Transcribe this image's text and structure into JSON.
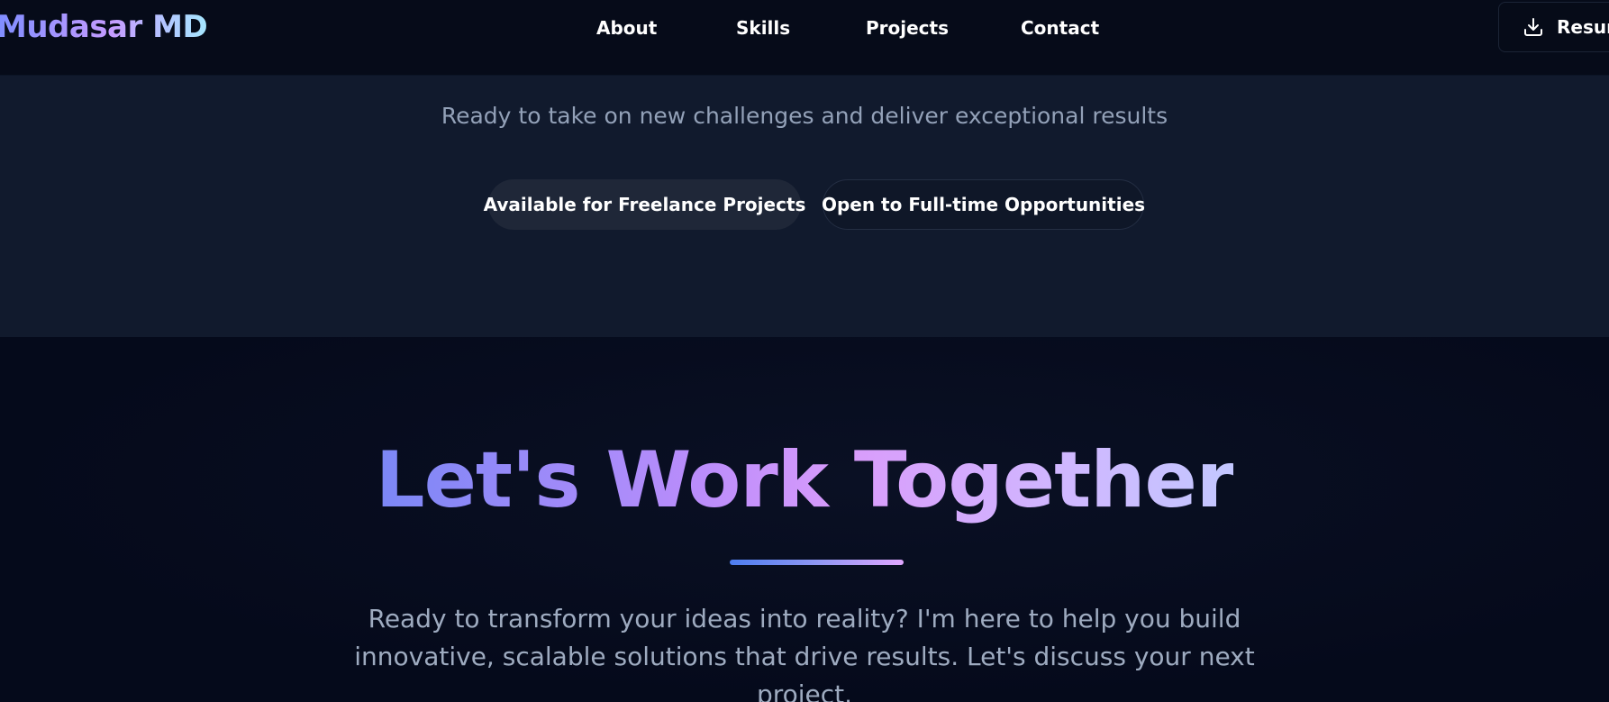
{
  "nav": {
    "logo": "Mudasar MD",
    "links": [
      "About",
      "Skills",
      "Projects",
      "Contact"
    ],
    "resume_label": "Resume",
    "resume_icon": "download-icon"
  },
  "availability": {
    "subtitle": "Ready to take on new challenges and deliver exceptional results",
    "badges": [
      "Available for Freelance Projects",
      "Open to Full-time Opportunities"
    ]
  },
  "cta": {
    "title": "Let's Work Together",
    "body": "Ready to transform your ideas into reality? I'm here to help you build innovative, scalable solutions that drive results. Let's discuss your next project."
  },
  "colors": {
    "background": "#050a1a",
    "section_bg": "#111a2d",
    "accent_blue": "#7b87f6",
    "accent_purple": "#d99cfb",
    "muted_text": "#93a1b8"
  }
}
